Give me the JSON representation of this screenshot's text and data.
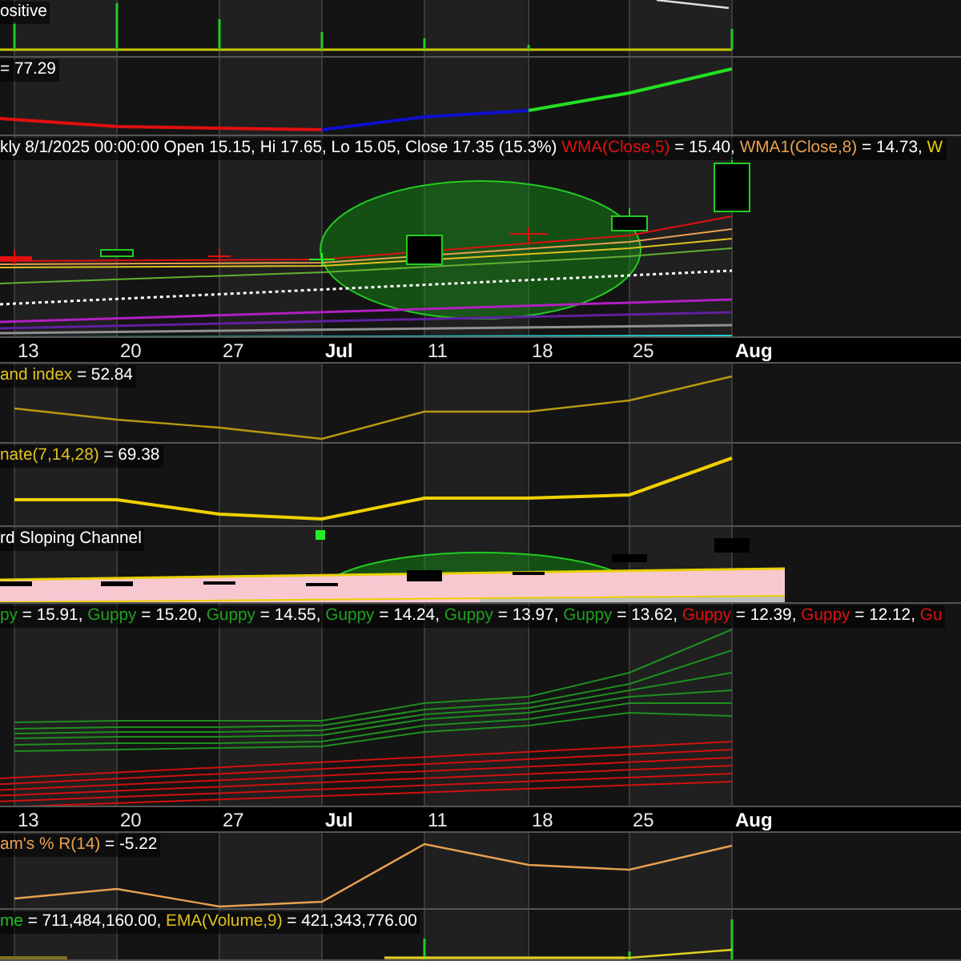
{
  "panes": [
    {
      "kind": "spikes",
      "legend": [
        {
          "text": "ositive",
          "color": "#ffffff"
        }
      ]
    },
    {
      "kind": "trend",
      "legend": [
        {
          "text": "= 77.29",
          "color": "#ffffff"
        }
      ]
    },
    {
      "kind": "price",
      "legend": [
        {
          "text": "kly 8/1/2025 00:00:00 Open 15.15, Hi 17.65, Lo 15.05, Close 17.35 (15.3%) ",
          "color": "#ffffff"
        },
        {
          "text": "WMA(Close,5)",
          "color": "#e01010"
        },
        {
          "text": " = 15.40, ",
          "color": "#ffffff"
        },
        {
          "text": "WMA1(Close,8)",
          "color": "#e8a050"
        },
        {
          "text": " = 14.73, ",
          "color": "#ffffff"
        },
        {
          "text": "W",
          "color": "#e8d000"
        }
      ]
    },
    {
      "kind": "axis",
      "labels": [
        {
          "text": "13",
          "kind": "day"
        },
        {
          "text": "20",
          "kind": "day"
        },
        {
          "text": "27",
          "kind": "day"
        },
        {
          "text": "Jul",
          "kind": "month"
        },
        {
          "text": "11",
          "kind": "day"
        },
        {
          "text": "18",
          "kind": "day"
        },
        {
          "text": "25",
          "kind": "day"
        },
        {
          "text": "Aug",
          "kind": "month"
        }
      ]
    },
    {
      "kind": "index-line",
      "legend": [
        {
          "text": "and index",
          "color": "#e0c020"
        },
        {
          "text": " = 52.84",
          "color": "#ffffff"
        }
      ]
    },
    {
      "kind": "rate-line",
      "legend": [
        {
          "text": "nate(7,14,28)",
          "color": "#e0c020"
        },
        {
          "text": " = 69.38",
          "color": "#ffffff"
        }
      ]
    },
    {
      "kind": "channel",
      "legend": [
        {
          "text": "rd Sloping Channel",
          "color": "#ffffff"
        }
      ]
    },
    {
      "kind": "guppy",
      "legend": [
        {
          "text": "py",
          "color": "#1fa01f"
        },
        {
          "text": " = 15.91, ",
          "color": "#ffffff"
        },
        {
          "text": "Guppy",
          "color": "#1fa01f"
        },
        {
          "text": " = 15.20, ",
          "color": "#ffffff"
        },
        {
          "text": "Guppy",
          "color": "#1fa01f"
        },
        {
          "text": " = 14.55, ",
          "color": "#ffffff"
        },
        {
          "text": "Guppy",
          "color": "#1fa01f"
        },
        {
          "text": " = 14.24, ",
          "color": "#ffffff"
        },
        {
          "text": "Guppy",
          "color": "#1fa01f"
        },
        {
          "text": " = 13.97, ",
          "color": "#ffffff"
        },
        {
          "text": "Guppy",
          "color": "#1fa01f"
        },
        {
          "text": " = 13.62, ",
          "color": "#ffffff"
        },
        {
          "text": "Guppy",
          "color": "#e01010"
        },
        {
          "text": " = 12.39, ",
          "color": "#ffffff"
        },
        {
          "text": "Guppy",
          "color": "#e01010"
        },
        {
          "text": " = 12.12, ",
          "color": "#ffffff"
        },
        {
          "text": "Gu",
          "color": "#e01010"
        }
      ]
    },
    {
      "kind": "axis",
      "labels": [
        {
          "text": "13",
          "kind": "day"
        },
        {
          "text": "20",
          "kind": "day"
        },
        {
          "text": "27",
          "kind": "day"
        },
        {
          "text": "Jul",
          "kind": "month"
        },
        {
          "text": "11",
          "kind": "day"
        },
        {
          "text": "18",
          "kind": "day"
        },
        {
          "text": "25",
          "kind": "day"
        },
        {
          "text": "Aug",
          "kind": "month"
        }
      ]
    },
    {
      "kind": "oscillator",
      "legend": [
        {
          "text": "am's % R(14)",
          "color": "#e8a050"
        },
        {
          "text": " = -5.22",
          "color": "#ffffff"
        }
      ]
    },
    {
      "kind": "volume",
      "legend": [
        {
          "text": "me",
          "color": "#1fc01f"
        },
        {
          "text": " = 711,484,160.00, ",
          "color": "#ffffff"
        },
        {
          "text": "EMA(Volume,9)",
          "color": "#e0c020"
        },
        {
          "text": " = 421,343,776.00",
          "color": "#ffffff"
        }
      ]
    }
  ]
}
